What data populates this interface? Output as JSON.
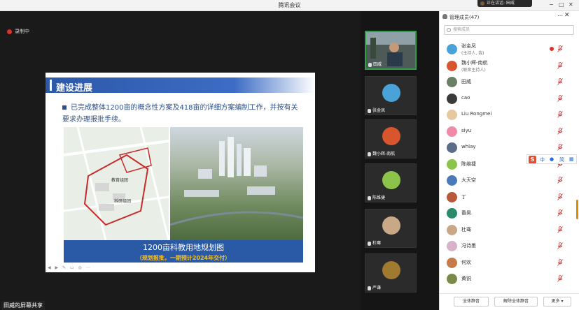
{
  "window": {
    "title": "腾讯会议",
    "speaking_label": "正在讲话: 田威"
  },
  "record": {
    "label": "录制中"
  },
  "slide": {
    "heading": "建设进展",
    "bullet": "已完成整体1200亩的概念性方案及418亩的详细方案编制工作，并按有关要求办理报批手续。",
    "map_labels": [
      "教育组团",
      "科研组团"
    ],
    "caption_line1": "1200亩科教用地规划图",
    "caption_line2": "（规划报批，一期预计2024年交付）"
  },
  "share": {
    "label": "田威的屏幕共享"
  },
  "videos": [
    {
      "name": "田威",
      "color": "#6a7f63",
      "active": true
    },
    {
      "name": "张金凤",
      "color": "#4aa3d8"
    },
    {
      "name": "魏小辉-南航",
      "color": "#d9552d"
    },
    {
      "name": "陈维捷",
      "color": "#8cc34a"
    },
    {
      "name": "杜骞",
      "color": "#c9a888"
    },
    {
      "name": "严谦",
      "color": "#a07a30"
    }
  ],
  "panel": {
    "title": "管理成员(47)",
    "search_placeholder": "搜索成员",
    "members": [
      {
        "name": "张金凤",
        "sub": "(主持人, 我)",
        "color": "#4aa3d8",
        "rec": true
      },
      {
        "name": "魏小辉-南航",
        "sub": "(联席主持人)",
        "color": "#d9552d"
      },
      {
        "name": "田威",
        "sub": "",
        "color": "#6a7f63"
      },
      {
        "name": "cao",
        "sub": "",
        "color": "#3a3a3a"
      },
      {
        "name": "Liu Rongmei",
        "sub": "",
        "color": "#e7c9a0"
      },
      {
        "name": "siyu",
        "sub": "",
        "color": "#f08aa8"
      },
      {
        "name": "whlay",
        "sub": "",
        "color": "#5b6e86"
      },
      {
        "name": "陈维捷",
        "sub": "",
        "color": "#8cc34a"
      },
      {
        "name": "大天空",
        "sub": "",
        "color": "#4a7ab8"
      },
      {
        "name": "丁",
        "sub": "",
        "color": "#b85a3a"
      },
      {
        "name": "番昊",
        "sub": "",
        "color": "#2a8a6a"
      },
      {
        "name": "杜骞",
        "sub": "",
        "color": "#c9a888"
      },
      {
        "name": "冯诗墨",
        "sub": "",
        "color": "#d8b2c8"
      },
      {
        "name": "何欢",
        "sub": "",
        "color": "#c77a4a"
      },
      {
        "name": "黄锐",
        "sub": "",
        "color": "#7a8a4a"
      }
    ],
    "buttons": {
      "mute_all": "全体静音",
      "unmute_all": "解除全体静音",
      "more": "更多 ▾"
    }
  },
  "ime": {
    "label": "S",
    "icons": [
      "中",
      "🎤",
      "简",
      "▦"
    ]
  }
}
